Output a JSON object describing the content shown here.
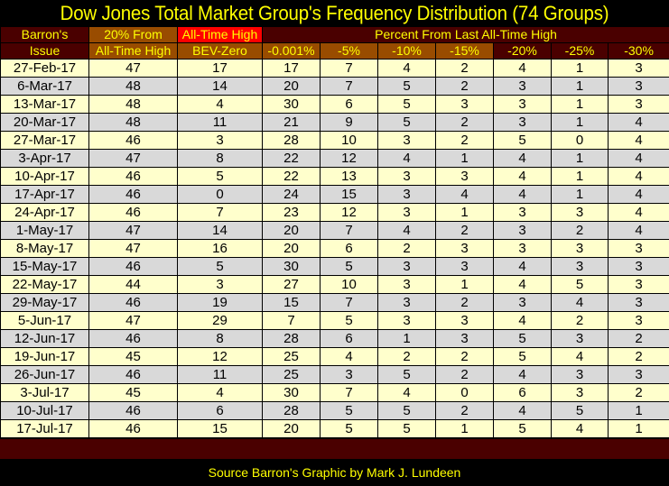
{
  "title": "Dow Jones Total Market Group's Frequency Distribution (74 Groups)",
  "header": {
    "issue_line1": "Barron's",
    "issue_line2": "Issue",
    "col20_line1": "20% From",
    "col20_line2": "All-Time High",
    "ath": "All-Time High",
    "bev_zero": "BEV-Zero",
    "percent_from": "Percent From Last All-Time High",
    "cols": [
      "-0.001%",
      "-5%",
      "-10%",
      "-15%",
      "-20%",
      "-25%",
      "-30%"
    ]
  },
  "rows": [
    [
      "27-Feb-17",
      "47",
      "17",
      "17",
      "7",
      "4",
      "2",
      "4",
      "1",
      "3"
    ],
    [
      "6-Mar-17",
      "48",
      "14",
      "20",
      "7",
      "5",
      "2",
      "3",
      "1",
      "3"
    ],
    [
      "13-Mar-17",
      "48",
      "4",
      "30",
      "6",
      "5",
      "3",
      "3",
      "1",
      "3"
    ],
    [
      "20-Mar-17",
      "48",
      "11",
      "21",
      "9",
      "5",
      "2",
      "3",
      "1",
      "4"
    ],
    [
      "27-Mar-17",
      "46",
      "3",
      "28",
      "10",
      "3",
      "2",
      "5",
      "0",
      "4"
    ],
    [
      "3-Apr-17",
      "47",
      "8",
      "22",
      "12",
      "4",
      "1",
      "4",
      "1",
      "4"
    ],
    [
      "10-Apr-17",
      "46",
      "5",
      "22",
      "13",
      "3",
      "3",
      "4",
      "1",
      "4"
    ],
    [
      "17-Apr-17",
      "46",
      "0",
      "24",
      "15",
      "3",
      "4",
      "4",
      "1",
      "4"
    ],
    [
      "24-Apr-17",
      "46",
      "7",
      "23",
      "12",
      "3",
      "1",
      "3",
      "3",
      "4"
    ],
    [
      "1-May-17",
      "47",
      "14",
      "20",
      "7",
      "4",
      "2",
      "3",
      "2",
      "4"
    ],
    [
      "8-May-17",
      "47",
      "16",
      "20",
      "6",
      "2",
      "3",
      "3",
      "3",
      "3"
    ],
    [
      "15-May-17",
      "46",
      "5",
      "30",
      "5",
      "3",
      "3",
      "4",
      "3",
      "3"
    ],
    [
      "22-May-17",
      "44",
      "3",
      "27",
      "10",
      "3",
      "1",
      "4",
      "5",
      "3"
    ],
    [
      "29-May-17",
      "46",
      "19",
      "15",
      "7",
      "3",
      "2",
      "3",
      "4",
      "3"
    ],
    [
      "5-Jun-17",
      "47",
      "29",
      "7",
      "5",
      "3",
      "3",
      "4",
      "2",
      "3"
    ],
    [
      "12-Jun-17",
      "46",
      "8",
      "28",
      "6",
      "1",
      "3",
      "5",
      "3",
      "2"
    ],
    [
      "19-Jun-17",
      "45",
      "12",
      "25",
      "4",
      "2",
      "2",
      "5",
      "4",
      "2"
    ],
    [
      "26-Jun-17",
      "46",
      "11",
      "25",
      "3",
      "5",
      "2",
      "4",
      "3",
      "3"
    ],
    [
      "3-Jul-17",
      "45",
      "4",
      "30",
      "7",
      "4",
      "0",
      "6",
      "3",
      "2"
    ],
    [
      "10-Jul-17",
      "46",
      "6",
      "28",
      "5",
      "5",
      "2",
      "4",
      "5",
      "1"
    ],
    [
      "17-Jul-17",
      "46",
      "15",
      "20",
      "5",
      "5",
      "1",
      "5",
      "4",
      "1"
    ]
  ],
  "footer": "Source Barron's  Graphic by Mark J. Lundeen",
  "colors": {
    "title": "#ffff00",
    "header_dark": "#4a0000",
    "header_brown": "#994c00",
    "ath_red": "#ff0000",
    "row_odd": "#ffffcc",
    "row_even": "#d9d9d9"
  }
}
